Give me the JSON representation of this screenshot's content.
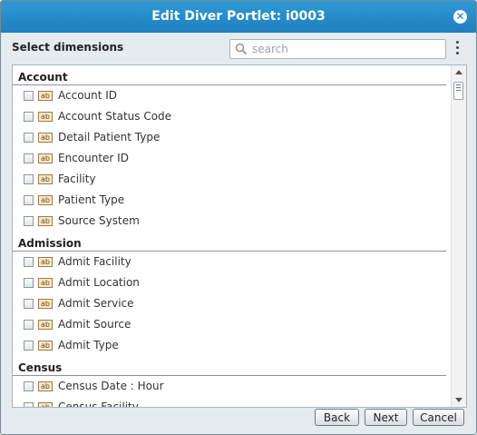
{
  "dialog": {
    "title": "Edit Diver Portlet: i0003",
    "close_icon": "close-icon"
  },
  "section_title": "Select dimensions",
  "search": {
    "placeholder": "search",
    "value": ""
  },
  "menu_icon": "kebab-menu-icon",
  "groups": [
    {
      "label": "Account",
      "items": [
        "Account ID",
        "Account Status Code",
        "Detail Patient Type",
        "Encounter ID",
        "Facility",
        "Patient Type",
        "Source System"
      ]
    },
    {
      "label": "Admission",
      "items": [
        "Admit Facility",
        "Admit Location",
        "Admit Service",
        "Admit Source",
        "Admit Type"
      ]
    },
    {
      "label": "Census",
      "items": [
        "Census Date : Hour",
        "Census Facility"
      ]
    }
  ],
  "item_type_icon_text": "ab",
  "buttons": {
    "back": "Back",
    "next": "Next",
    "cancel": "Cancel"
  },
  "colors": {
    "titlebar": "#1e7fbf",
    "background": "#e4ecf0"
  }
}
